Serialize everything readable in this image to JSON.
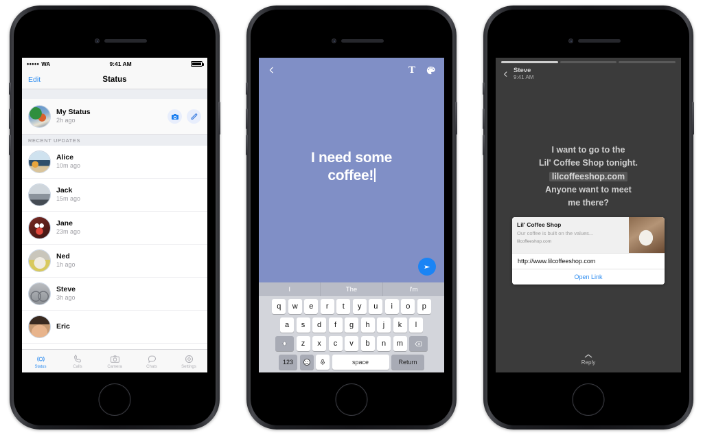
{
  "phone1": {
    "status_bar": {
      "signal_dots": "•••••",
      "carrier": "WA",
      "time": "9:41 AM"
    },
    "nav": {
      "edit": "Edit",
      "title": "Status"
    },
    "my_status": {
      "name": "My Status",
      "time": "2h ago",
      "camera_icon": "camera-icon",
      "edit_icon": "pencil-icon"
    },
    "section_header": "RECENT UPDATES",
    "contacts": [
      {
        "name": "Alice",
        "time": "10m ago",
        "photo": "ph-beach"
      },
      {
        "name": "Jack",
        "time": "15m ago",
        "photo": "ph-crowd"
      },
      {
        "name": "Jane",
        "time": "23m ago",
        "photo": "ph-jane"
      },
      {
        "name": "Ned",
        "time": "1h ago",
        "photo": "ph-dog"
      },
      {
        "name": "Steve",
        "time": "3h ago",
        "photo": "ph-bike"
      },
      {
        "name": "Eric",
        "time": "",
        "photo": "ph-eric"
      }
    ],
    "tabs": [
      {
        "label": "Status",
        "icon": "status-rings-icon",
        "active": true
      },
      {
        "label": "Calls",
        "icon": "phone-icon",
        "active": false
      },
      {
        "label": "Camera",
        "icon": "camera-icon",
        "active": false
      },
      {
        "label": "Chats",
        "icon": "chat-bubble-icon",
        "active": false
      },
      {
        "label": "Settings",
        "icon": "gear-icon",
        "active": false
      }
    ],
    "accent_color": "#2d8cf0"
  },
  "phone2": {
    "back_icon": "chevron-left-icon",
    "text_tool_label": "T",
    "palette_icon": "palette-icon",
    "composer_text_line1": "I need some",
    "composer_text_line2": "coffee!",
    "send_icon": "send-icon",
    "background_color": "#808fc6",
    "keyboard": {
      "predictions": [
        "I",
        "The",
        "I'm"
      ],
      "row1": [
        "q",
        "w",
        "e",
        "r",
        "t",
        "y",
        "u",
        "i",
        "o",
        "p"
      ],
      "row2": [
        "a",
        "s",
        "d",
        "f",
        "g",
        "h",
        "j",
        "k",
        "l"
      ],
      "row3": [
        "z",
        "x",
        "c",
        "v",
        "b",
        "n",
        "m"
      ],
      "shift_icon": "shift-icon",
      "backspace_icon": "backspace-icon",
      "numbers_key": "123",
      "emoji_icon": "emoji-icon",
      "mic_icon": "microphone-icon",
      "space_key": "space",
      "return_key": "Return"
    }
  },
  "phone3": {
    "progress_segments": [
      true,
      false,
      false
    ],
    "back_icon": "chevron-left-icon",
    "author": "Steve",
    "timestamp": "9:41 AM",
    "story_line1": "I want to go to the",
    "story_line2": "Lil' Coffee Shop tonight.",
    "story_link": "lilcoffeeshop.com",
    "story_line3": "Anyone want to meet",
    "story_line4": "me there?",
    "preview": {
      "title": "Lil' Coffee Shop",
      "description": "Our coffee is built on the values...",
      "domain": "lilcoffeeshop.com",
      "url": "http://www.lilcoffeeshop.com",
      "open_label": "Open Link",
      "thumbnail": "coffee-cup-photo"
    },
    "reply": {
      "icon": "chevron-up-icon",
      "label": "Reply"
    },
    "background_color": "#3b3b3b"
  }
}
